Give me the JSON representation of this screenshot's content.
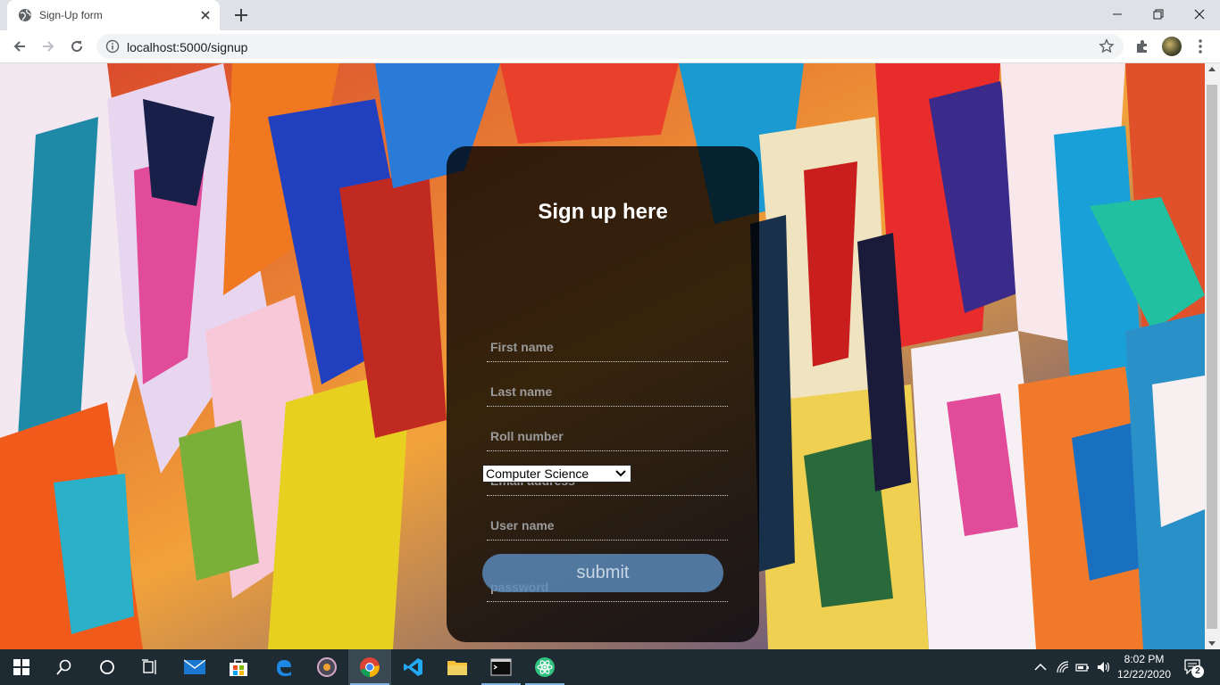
{
  "browser": {
    "tab_title": "Sign-Up form",
    "url": "localhost:5000/signup"
  },
  "form": {
    "title": "Sign up here",
    "first_name_placeholder": "First name",
    "last_name_placeholder": "Last name",
    "roll_number_placeholder": "Roll number",
    "email_placeholder": "Email address",
    "username_placeholder": "User name",
    "department_selected": "Computer Science",
    "password_placeholder": "password",
    "submit_label": "submit"
  },
  "taskbar": {
    "time": "8:02 PM",
    "date": "12/22/2020",
    "notification_count": "2",
    "pinned_apps": [
      "start-icon",
      "search-icon",
      "cortana-icon",
      "task-view-icon",
      "mail-icon",
      "store-icon",
      "edge-icon",
      "media-icon",
      "chrome-icon",
      "vscode-icon",
      "file-explorer-icon",
      "terminal-icon",
      "atom-icon"
    ]
  },
  "colors": {
    "card_bg": "#000000c7",
    "submit_bg": "#5c8cbe",
    "taskbar_bg": "#1f2b33"
  }
}
